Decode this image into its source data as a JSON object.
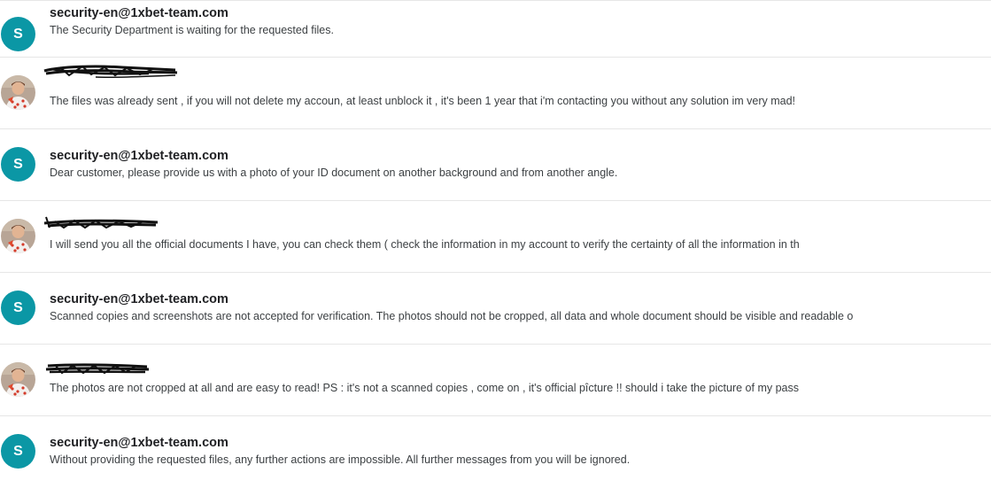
{
  "colors": {
    "avatar_bg": "#0b97a5",
    "divider": "#e6e6e6",
    "sender_text": "#202124",
    "snippet_text": "#3c4043"
  },
  "messages": [
    {
      "kind": "support",
      "avatar_letter": "S",
      "sender": "security-en@1xbet-team.com",
      "snippet": "The Security Department is waiting for the requested files."
    },
    {
      "kind": "user",
      "avatar_icon": "user-photo-icon",
      "sender_redacted": true,
      "snippet": "The files was already sent , if you will not delete my accoun, at least unblock it , it's been 1 year that i'm contacting you without any solution im very mad!"
    },
    {
      "kind": "support",
      "avatar_letter": "S",
      "sender": "security-en@1xbet-team.com",
      "snippet": "Dear customer, please provide us with a photo of your ID document on another background and from another angle."
    },
    {
      "kind": "user",
      "avatar_icon": "user-photo-icon",
      "sender_redacted": true,
      "snippet": "I will send you all the official documents I have, you can check them ( check the information in my account to verify the certainty of all the information in th"
    },
    {
      "kind": "support",
      "avatar_letter": "S",
      "sender": "security-en@1xbet-team.com",
      "snippet": "Scanned copies and screenshots are not accepted for verification. The photos should not be cropped, all data and whole document should be visible and readable o"
    },
    {
      "kind": "user",
      "avatar_icon": "user-photo-icon",
      "sender_redacted": true,
      "snippet": "The photos are not cropped at all and are easy to read! PS : it's not a scanned copies , come on , it's official pîcture !! should i take the picture of my pass"
    },
    {
      "kind": "support",
      "avatar_letter": "S",
      "sender": "security-en@1xbet-team.com",
      "snippet": "Without providing the requested files, any further actions are impossible. All further messages from you will be ignored."
    }
  ]
}
